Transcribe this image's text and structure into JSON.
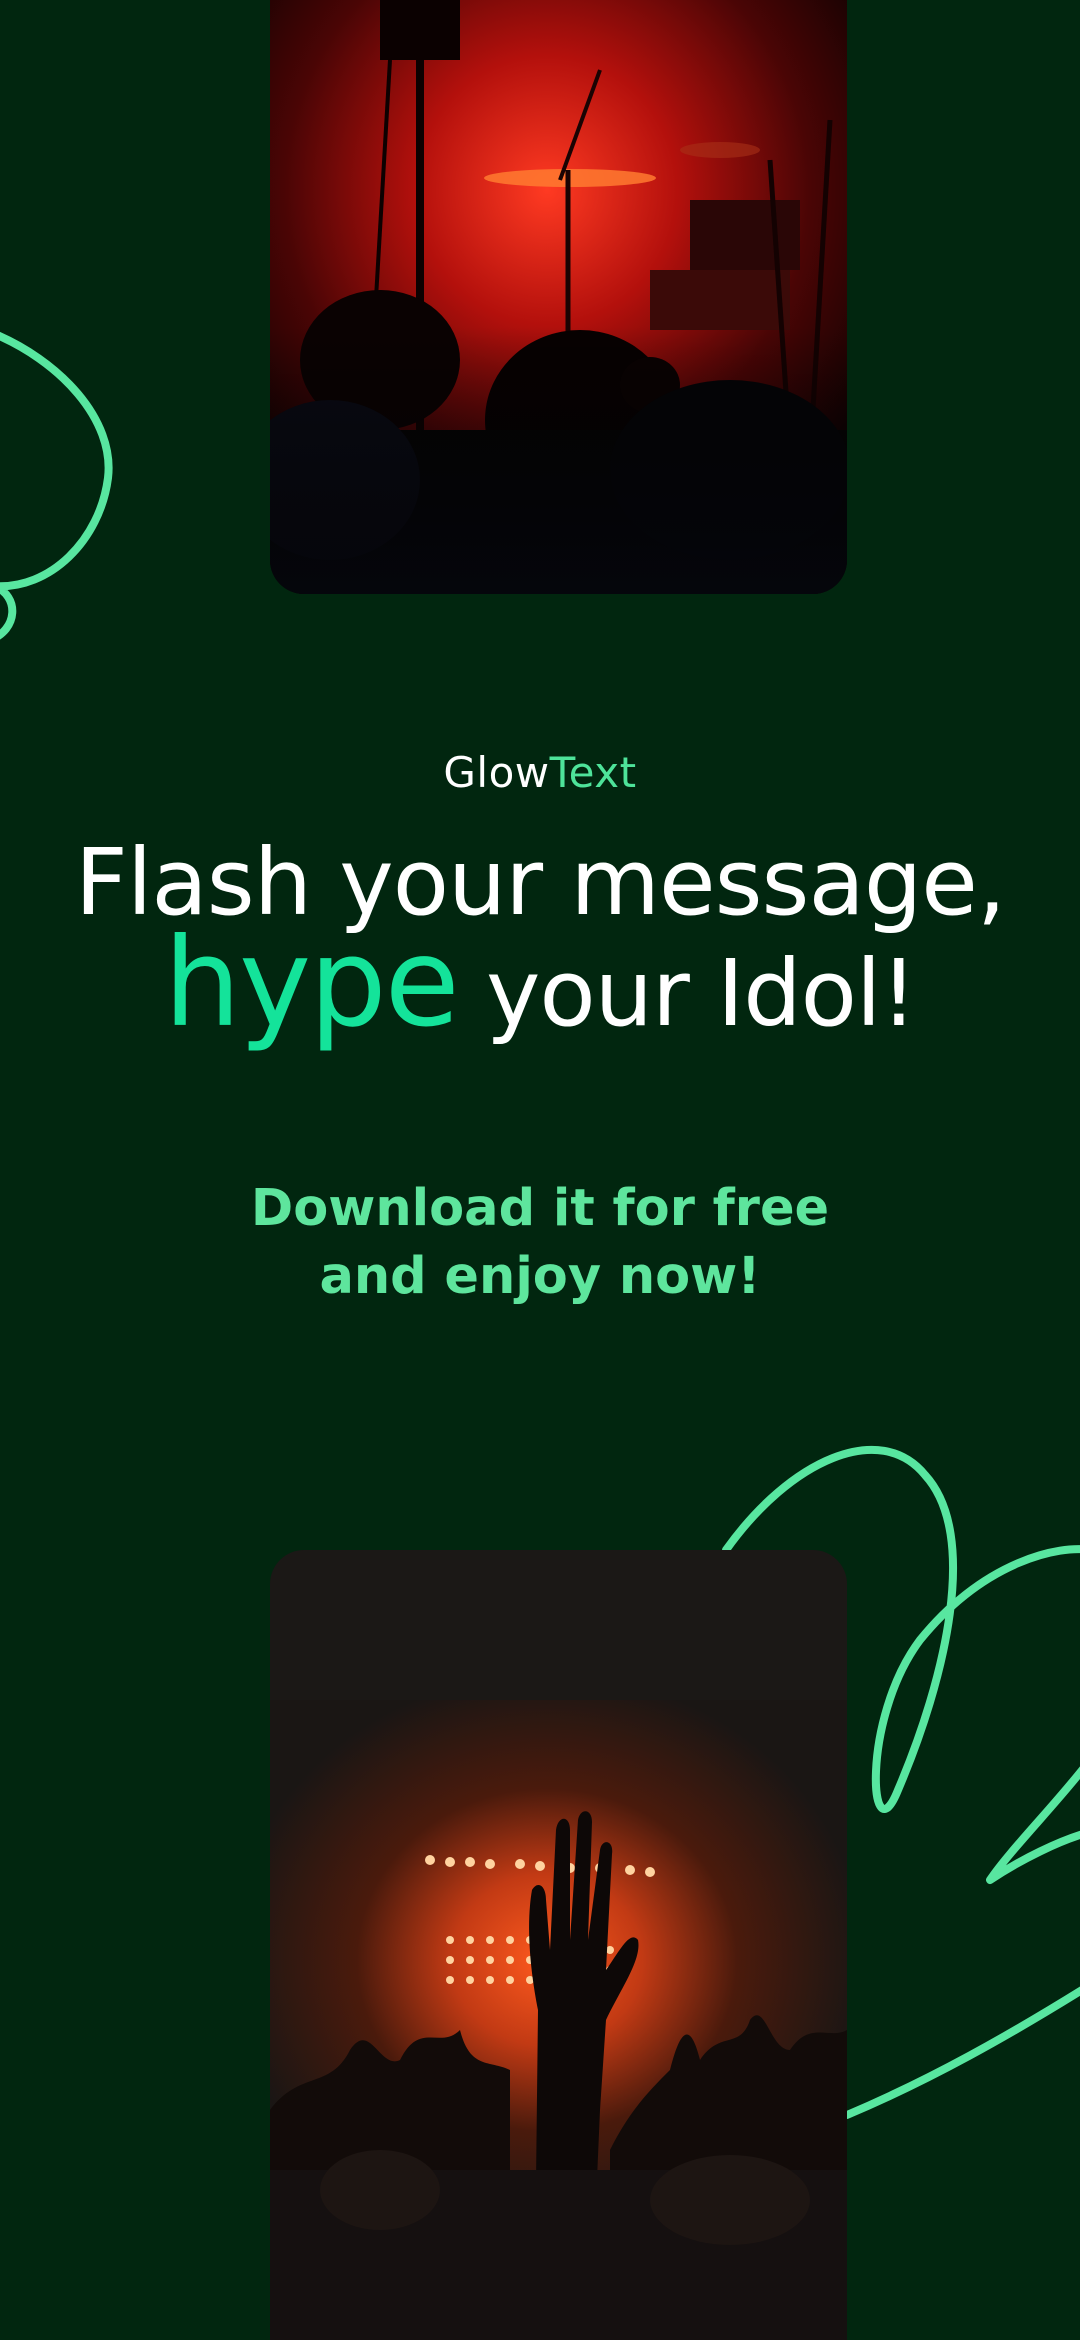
{
  "brand": {
    "part1": "Glow",
    "part2": "Text"
  },
  "headline": {
    "line1": "Flash your message,",
    "highlight": "hype",
    "line2_rest": " your Idol!"
  },
  "cta": {
    "line1": "Download it for free",
    "line2": "and enjoy now!"
  },
  "colors": {
    "background": "#01260f",
    "accent": "#14e39a",
    "cta": "#5ee59d",
    "squiggle": "#58e6a0"
  }
}
